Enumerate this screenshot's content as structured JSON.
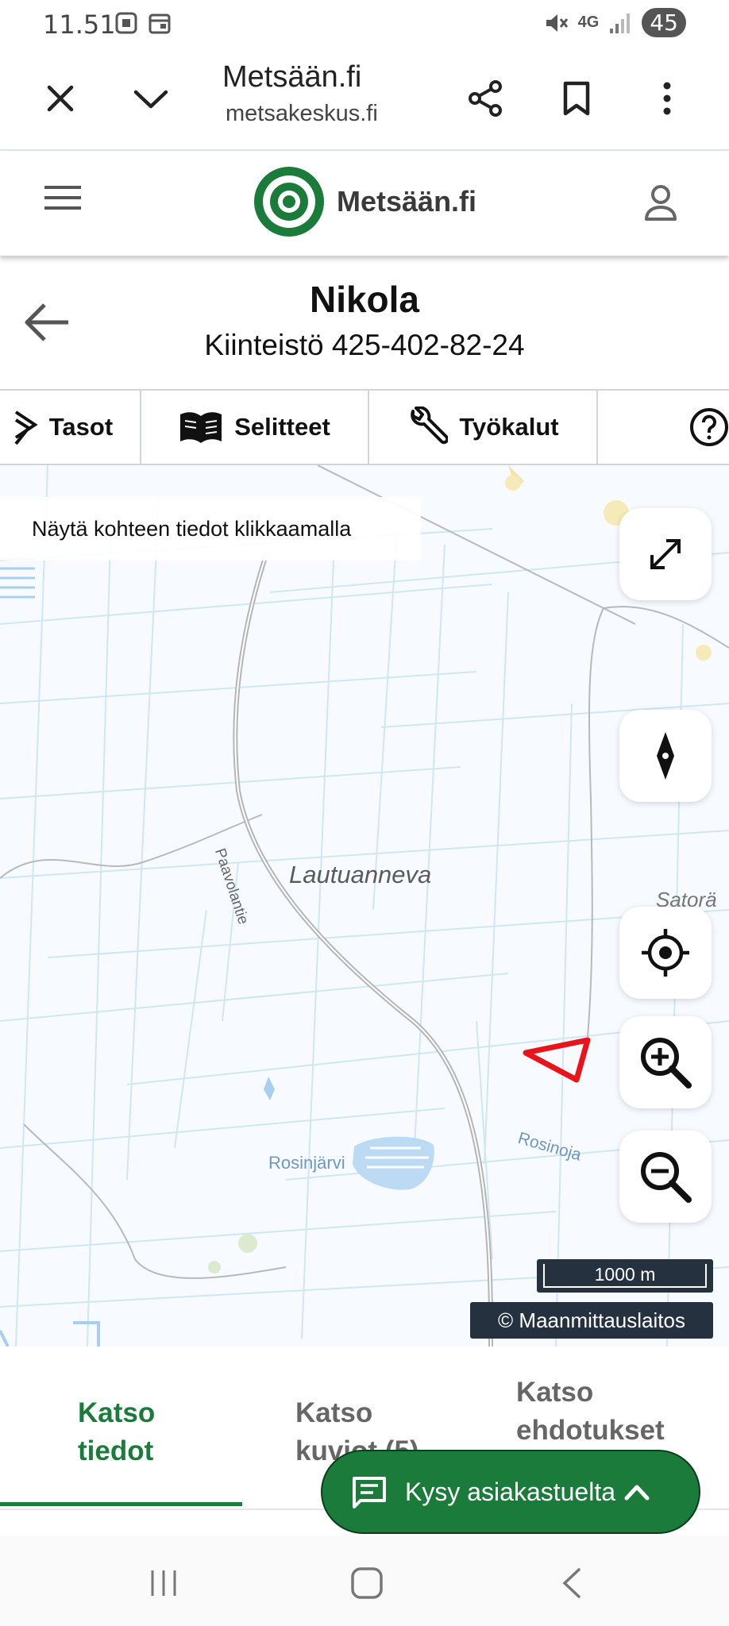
{
  "status_bar": {
    "time": "11.51",
    "network": "4G",
    "battery": "45"
  },
  "browser": {
    "title": "Metsään.fi",
    "url": "metsakeskus.fi"
  },
  "site": {
    "logo_text": "Metsään.fi",
    "brand_color": "#1b7b3a"
  },
  "page": {
    "title": "Nikola",
    "subtitle": "Kiinteistö 425-402-82-24"
  },
  "tool_tabs": [
    {
      "label": "Tasot",
      "icon": "layers-icon"
    },
    {
      "label": "Selitteet",
      "icon": "book-icon"
    },
    {
      "label": "Työkalut",
      "icon": "wrench-icon"
    },
    {
      "label": "",
      "icon": "help-icon"
    }
  ],
  "map": {
    "hint": "Näytä kohteen tiedot klikkaamalla",
    "labels": {
      "lautuanneva": "Lautuanneva",
      "paavolantie": "Paavolantie",
      "rosinjarvi": "Rosinjärvi",
      "rosinoja": "Rosinoja",
      "satora": "Satorä"
    },
    "scale": "1000 m",
    "copyright": "© Maanmittauslaitos",
    "controls": [
      "fullscreen-icon",
      "compass-icon",
      "locate-icon",
      "zoom-in-icon",
      "zoom-out-icon"
    ]
  },
  "bottom_tabs": [
    {
      "line1": "Katso",
      "line2": "tiedot",
      "active": true
    },
    {
      "line1": "Katso",
      "line2": "kuviot (5)",
      "active": false
    },
    {
      "line1": "Katso",
      "line2": "ehdotukset",
      "active": false
    }
  ],
  "chat_button": {
    "label": "Kysy asiakastuelta"
  }
}
